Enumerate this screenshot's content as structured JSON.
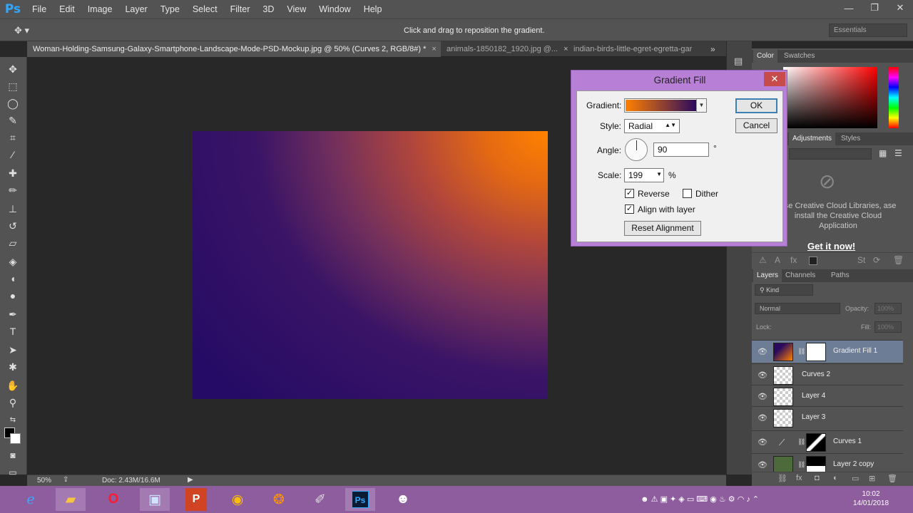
{
  "app": {
    "logo": "Ps"
  },
  "menu": [
    "File",
    "Edit",
    "Image",
    "Layer",
    "Type",
    "Select",
    "Filter",
    "3D",
    "View",
    "Window",
    "Help"
  ],
  "window_controls": {
    "minimize": "—",
    "restore": "❐",
    "close": "✕"
  },
  "options_bar": {
    "tool_icon": "move-tool-icon",
    "tool_glyph": "✥ ▾",
    "hint": "Click and drag to reposition the gradient.",
    "workspace": "Essentials"
  },
  "tabs": [
    {
      "label": "Woman-Holding-Samsung-Galaxy-Smartphone-Landscape-Mode-PSD-Mockup.jpg @ 50% (Curves 2, RGB/8#) *",
      "close": "×"
    },
    {
      "label": "animals-1850182_1920.jpg @...",
      "close": "×"
    },
    {
      "label": "indian-birds-little-egret-egretta-gar",
      "close": ""
    }
  ],
  "tab_overflow": "»",
  "status": {
    "zoom": "50%",
    "doc": "Doc: 2.43M/16.6M",
    "arrow": "▶"
  },
  "color_panel": {
    "tabs": [
      "Color",
      "Swatches"
    ]
  },
  "adjust_panel": {
    "tabs": [
      "Adjustments",
      "Styles"
    ],
    "cc_message": "use Creative Cloud Libraries, ase install the Creative Cloud Application",
    "cc_link": "Get it now!"
  },
  "layers_panel": {
    "tabs": [
      "Layers",
      "Channels",
      "Paths"
    ],
    "filter": "Kind",
    "blend_mode": "Normal",
    "opacity_label": "Opacity:",
    "opacity_value": "100%",
    "lock_label": "Lock:",
    "fill_label": "Fill:",
    "fill_value": "100%",
    "layers": [
      {
        "name": "Gradient Fill 1",
        "selected": true
      },
      {
        "name": "Curves 2"
      },
      {
        "name": "Layer 4"
      },
      {
        "name": "Layer 3"
      },
      {
        "name": "Curves 1"
      },
      {
        "name": "Layer 2 copy"
      }
    ]
  },
  "dialog": {
    "title": "Gradient Fill",
    "close": "✕",
    "gradient_label": "Gradient:",
    "style_label": "Style:",
    "style_value": "Radial",
    "angle_label": "Angle:",
    "angle_value": "90",
    "angle_unit": "°",
    "scale_label": "Scale:",
    "scale_value": "199",
    "scale_unit": "%",
    "reverse_label": "Reverse",
    "reverse_checked": true,
    "dither_label": "Dither",
    "dither_checked": false,
    "align_label": "Align with layer",
    "align_checked": true,
    "reset_label": "Reset Alignment",
    "ok_label": "OK",
    "cancel_label": "Cancel",
    "gradient_colors": [
      "#ff8000",
      "#2a0a5e"
    ]
  },
  "taskbar": {
    "icons": [
      "ie-icon",
      "file-explorer-icon",
      "opera-icon",
      "remote-desktop-icon",
      "powerpoint-icon",
      "chrome-icon",
      "firefox-icon",
      "gimp-icon",
      "photoshop-icon",
      "discord-icon"
    ],
    "time": "10:02",
    "date": "14/01/2018"
  },
  "colors": {
    "accent": "#31a8ff",
    "taskbar": "#8e5d9e",
    "dialog_frame": "#b87fd6",
    "selected_layer": "#6d7d95"
  }
}
